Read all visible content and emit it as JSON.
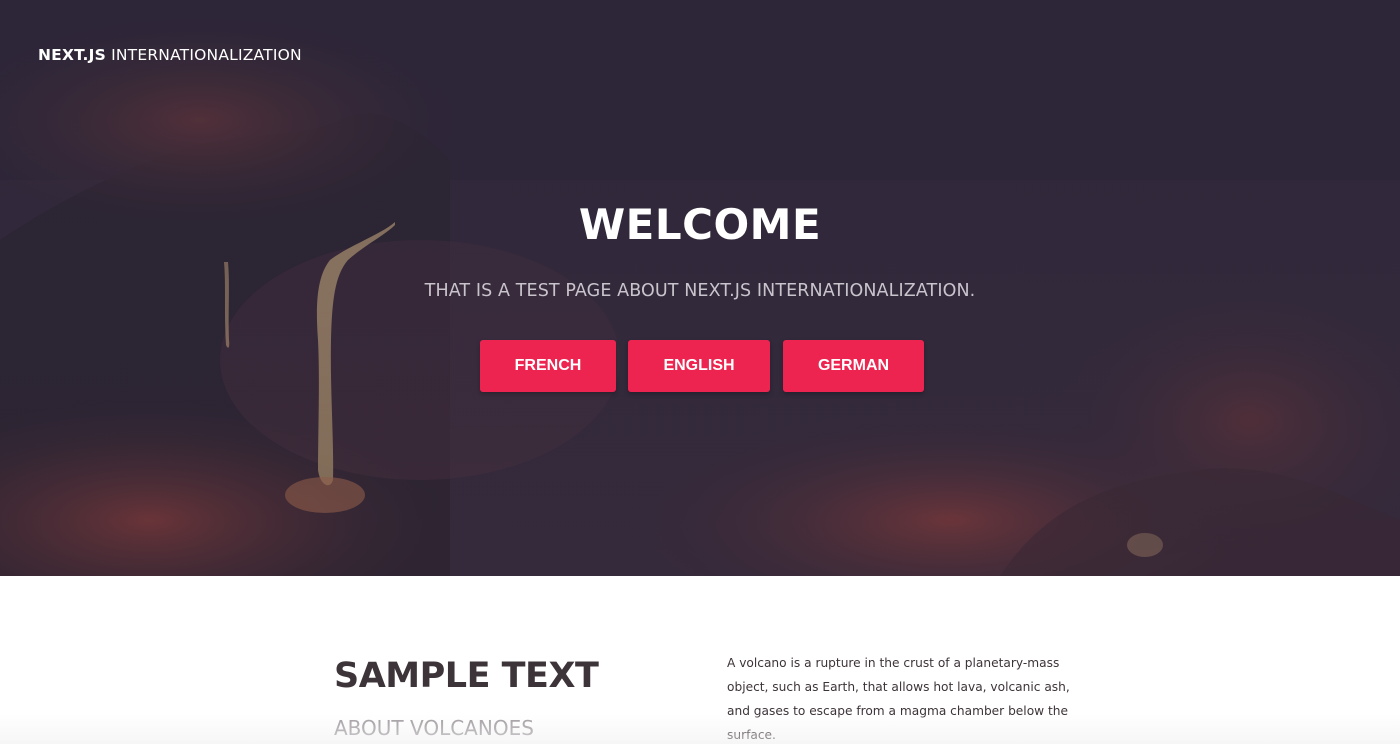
{
  "header": {
    "brand_bold": "NEXT.JS",
    "brand_light": "INTERNATIONALIZATION"
  },
  "hero": {
    "title": "WELCOME",
    "subtitle": "THAT IS A TEST PAGE ABOUT NEXT.JS INTERNATIONALIZATION.",
    "background_image": "volcano-lava-photo",
    "buttons": {
      "french": "FRENCH",
      "english": "ENGLISH",
      "german": "GERMAN"
    }
  },
  "content": {
    "title": "SAMPLE TEXT",
    "subtitle": "ABOUT VOLCANOES",
    "body": "A volcano is a rupture in the crust of a planetary-mass object, such as Earth, that allows hot lava, volcanic ash, and gases to escape from a magma chamber below the surface."
  },
  "colors": {
    "accent": "#ee2450",
    "hero_dark": "#2e2836",
    "heading_text": "#3d3439",
    "muted_text": "#a09ba0"
  }
}
